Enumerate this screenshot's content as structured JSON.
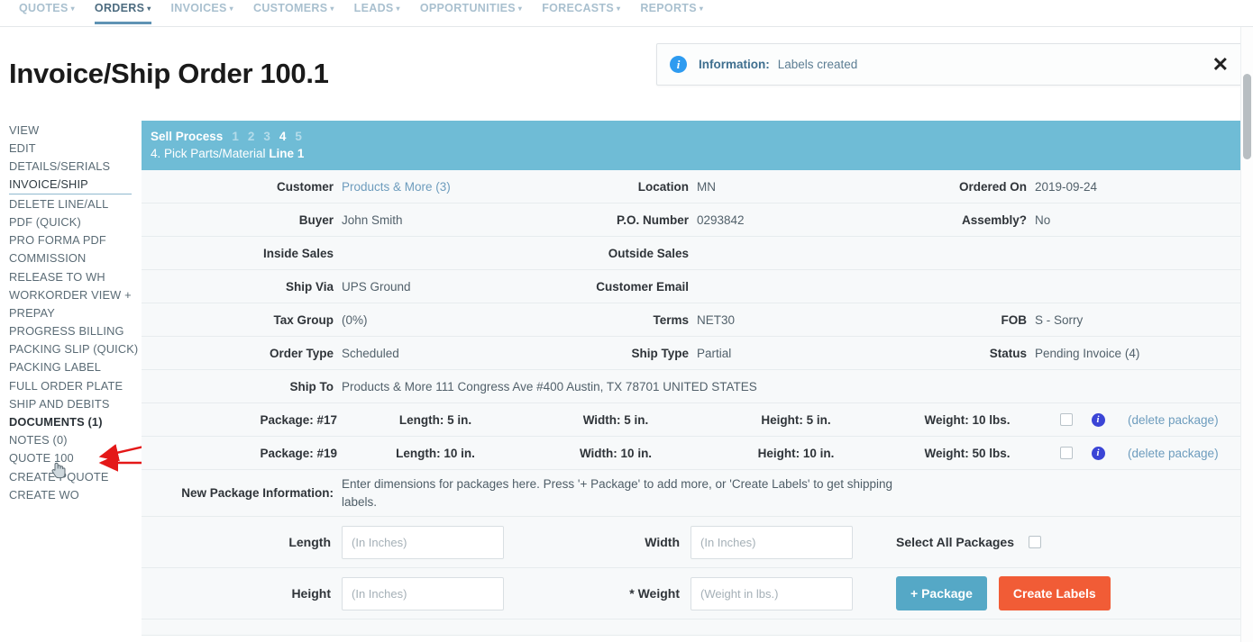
{
  "topnav": {
    "items": [
      {
        "label": "QUOTES",
        "caret": "▾",
        "active": false
      },
      {
        "label": "ORDERS",
        "caret": "▾",
        "active": true
      },
      {
        "label": "INVOICES",
        "caret": "▾",
        "active": false
      },
      {
        "label": "CUSTOMERS",
        "caret": "▾",
        "active": false
      },
      {
        "label": "LEADS",
        "caret": "▾",
        "active": false
      },
      {
        "label": "OPPORTUNITIES",
        "caret": "▾",
        "active": false
      },
      {
        "label": "FORECASTS",
        "caret": "▾",
        "active": false
      },
      {
        "label": "REPORTS",
        "caret": "▾",
        "active": false
      }
    ]
  },
  "page_title": "Invoice/Ship Order 100.1",
  "banner": {
    "icon": "info-icon",
    "label": "Information:",
    "text": "Labels created",
    "close": "✕",
    "accent_color": "#2e9bf0"
  },
  "sidebar": {
    "items": [
      {
        "label": "VIEW"
      },
      {
        "label": "EDIT"
      },
      {
        "label": "DETAILS/SERIALS"
      },
      {
        "label": "INVOICE/SHIP"
      },
      {
        "label": "DELETE LINE/ALL"
      },
      {
        "label": "PDF (QUICK)"
      },
      {
        "label": "PRO FORMA PDF"
      },
      {
        "label": "COMMISSION"
      },
      {
        "label": "RELEASE TO WH"
      },
      {
        "label": "WORKORDER VIEW +"
      },
      {
        "label": "PREPAY"
      },
      {
        "label": "PROGRESS BILLING"
      },
      {
        "label": "PACKING SLIP (QUICK)"
      },
      {
        "label": "PACKING LABEL"
      },
      {
        "label": "FULL ORDER PLATE"
      },
      {
        "label": "SHIP AND DEBITS"
      },
      {
        "label": "DOCUMENTS (1)"
      },
      {
        "label": "NOTES (0)"
      },
      {
        "label": "QUOTE 100"
      },
      {
        "label": "CREATE PQUOTE"
      },
      {
        "label": "CREATE WO"
      }
    ]
  },
  "process": {
    "title": "Sell Process",
    "steps": [
      "1",
      "2",
      "3",
      "4",
      "5"
    ],
    "current_step": "4",
    "step_label": "4. Pick Parts/Material",
    "step_line": "Line 1",
    "bar_color": "#6fbcd6"
  },
  "details": [
    {
      "col1_label": "Customer",
      "col1_value": "Products & More (3)",
      "col1_is_link": true,
      "col2_label": "Location",
      "col2_value": "MN",
      "col3_label": "Ordered On",
      "col3_value": "2019-09-24"
    },
    {
      "col1_label": "Buyer",
      "col1_value": "John Smith",
      "col1_is_link": false,
      "col2_label": "P.O. Number",
      "col2_value": "0293842",
      "col3_label": "Assembly?",
      "col3_value": "No"
    },
    {
      "col1_label": "Inside Sales",
      "col1_value": "",
      "col1_is_link": false,
      "col2_label": "Outside Sales",
      "col2_value": "",
      "col3_label": "",
      "col3_value": ""
    },
    {
      "col1_label": "Ship Via",
      "col1_value": "UPS Ground",
      "col1_is_link": false,
      "col2_label": "Customer Email",
      "col2_value": "",
      "col3_label": "",
      "col3_value": ""
    },
    {
      "col1_label": "Tax Group",
      "col1_value": "(0%)",
      "col1_is_link": false,
      "col2_label": "Terms",
      "col2_value": "NET30",
      "col3_label": "FOB",
      "col3_value": "S - Sorry"
    },
    {
      "col1_label": "Order Type",
      "col1_value": "Scheduled",
      "col1_is_link": false,
      "col2_label": "Ship Type",
      "col2_value": "Partial",
      "col3_label": "Status",
      "col3_value": "Pending Invoice (4)"
    }
  ],
  "ship_to": {
    "label": "Ship To",
    "value": "Products & More 111 Congress Ave #400 Austin, TX 78701 UNITED STATES"
  },
  "packages": [
    {
      "name": "Package: #17",
      "length": "Length: 5 in.",
      "width": "Width: 5 in.",
      "height": "Height: 5 in.",
      "weight": "Weight: 10 lbs.",
      "checked": false,
      "delete_label": "(delete package)"
    },
    {
      "name": "Package: #19",
      "length": "Length: 10 in.",
      "width": "Width: 10 in.",
      "height": "Height: 10 in.",
      "weight": "Weight: 50 lbs.",
      "checked": false,
      "delete_label": "(delete package)"
    }
  ],
  "new_package": {
    "label": "New Package Information:",
    "text": "Enter dimensions for packages here. Press '+ Package' to add more, or 'Create Labels' to get shipping labels."
  },
  "form": {
    "length_label": "Length",
    "length_value": "",
    "length_placeholder": "(In Inches)",
    "width_label": "Width",
    "width_value": "",
    "width_placeholder": "(In Inches)",
    "height_label": "Height",
    "height_value": "",
    "height_placeholder": "(In Inches)",
    "weight_label": "Weight",
    "weight_required_mark": "*",
    "weight_value": "",
    "weight_placeholder": "(Weight in lbs.)",
    "select_all_label": "Select All Packages",
    "select_all_checked": false,
    "add_package_label": "+ Package",
    "add_package_color": "#55a8c6",
    "create_labels_label": "Create Labels",
    "create_labels_color": "#f15c36"
  }
}
